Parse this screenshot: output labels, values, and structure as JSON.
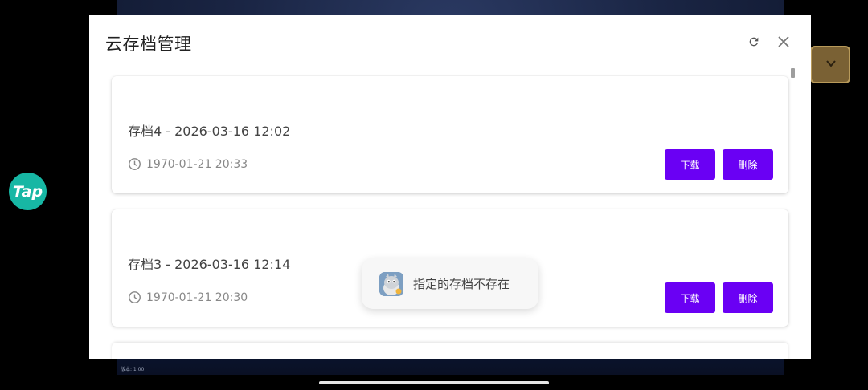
{
  "background": {
    "version_label": "版本: 1.00",
    "tap_label": "Tap"
  },
  "modal": {
    "title": "云存档管理",
    "refresh_icon": "refresh-icon",
    "close_icon": "close-icon"
  },
  "saves": [
    {
      "title": "存档4 - 2026-03-16 12:02",
      "time": "1970-01-21 20:33",
      "download_label": "下载",
      "delete_label": "删除"
    },
    {
      "title": "存档3 - 2026-03-16 12:14",
      "time": "1970-01-21 20:30",
      "download_label": "下载",
      "delete_label": "删除"
    }
  ],
  "toast": {
    "message": "指定的存档不存在"
  },
  "colors": {
    "accent": "#6a00f4",
    "tap_brand": "#17b7a4"
  }
}
